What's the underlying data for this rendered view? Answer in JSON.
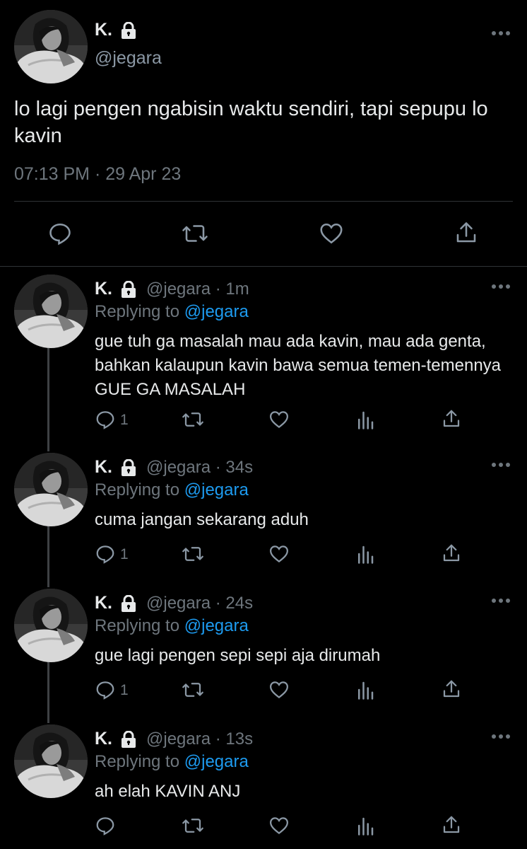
{
  "main_tweet": {
    "display_name": "K.",
    "handle": "@jegara",
    "text": "lo lagi pengen ngabisin waktu sendiri, tapi sepupu lo kavin",
    "timestamp": "07:13 PM · 29 Apr 23",
    "actions": [
      "reply-icon",
      "retweet-icon",
      "like-icon",
      "share-icon"
    ]
  },
  "replies": [
    {
      "display_name": "K.",
      "handle_time": "@jegara · 1m",
      "replying_prefix": "Replying to ",
      "replying_to": "@jegara",
      "text": "gue tuh ga masalah mau ada kavin, mau ada genta, bahkan kalaupun kavin bawa semua temen-temennya GUE GA MASALAH",
      "reply_count": "1"
    },
    {
      "display_name": "K.",
      "handle_time": "@jegara · 34s",
      "replying_prefix": "Replying to ",
      "replying_to": "@jegara",
      "text": "cuma jangan sekarang aduh",
      "reply_count": "1"
    },
    {
      "display_name": "K.",
      "handle_time": "@jegara · 24s",
      "replying_prefix": "Replying to ",
      "replying_to": "@jegara",
      "text": "gue lagi pengen sepi sepi aja dirumah",
      "reply_count": "1"
    },
    {
      "display_name": "K.",
      "handle_time": "@jegara · 13s",
      "replying_prefix": "Replying to ",
      "replying_to": "@jegara",
      "text": "ah elah KAVIN ANJ",
      "reply_count": ""
    }
  ],
  "colors": {
    "background": "#000000",
    "text": "#e7e9ea",
    "secondary": "#6e767d",
    "mention": "#1d9bf0",
    "divider": "#2f3336"
  }
}
